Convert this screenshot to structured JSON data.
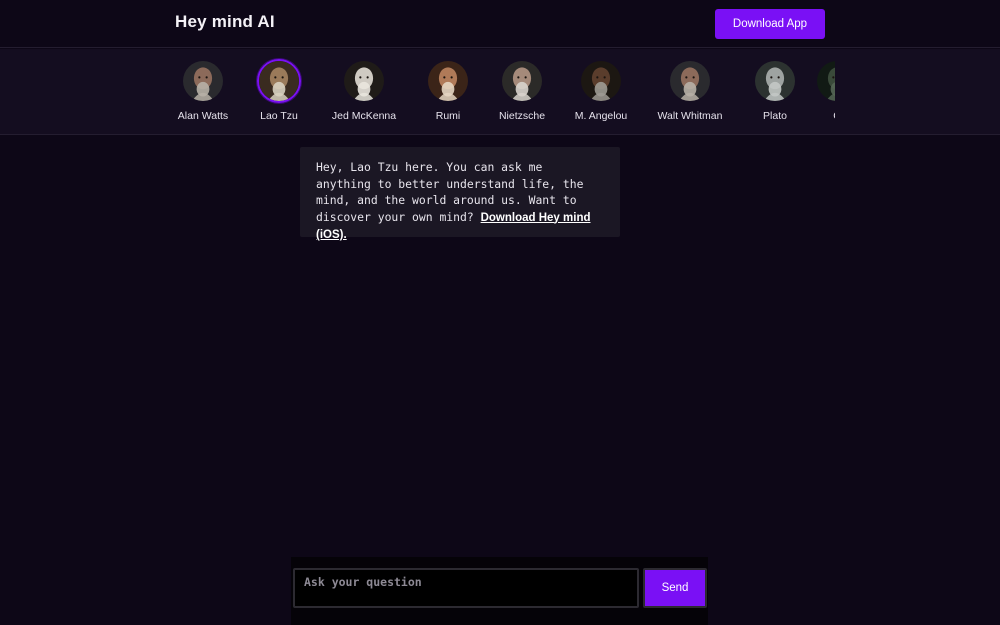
{
  "header": {
    "brand": "Hey mind AI",
    "download_label": "Download App"
  },
  "personas": [
    {
      "name": "Alan Watts",
      "icon": "portrait-bald-man-icon",
      "skin": "#8c6a5a",
      "bg": "#2a2a2e",
      "hair": "#b7b0a6",
      "active": false
    },
    {
      "name": "Lao Tzu",
      "icon": "portrait-elder-beard-icon",
      "skin": "#9a7a5a",
      "bg": "#3a2b20",
      "hair": "#d8d0c0",
      "active": true
    },
    {
      "name": "Jed McKenna",
      "icon": "portrait-dog-icon",
      "skin": "#cfcac2",
      "bg": "#1f1b18",
      "hair": "#e9e5de",
      "active": false
    },
    {
      "name": "Rumi",
      "icon": "portrait-turban-man-icon",
      "skin": "#b07a58",
      "bg": "#3b2418",
      "hair": "#e5d6c2",
      "active": false
    },
    {
      "name": "Nietzsche",
      "icon": "portrait-mustache-man-icon",
      "skin": "#a58a7a",
      "bg": "#2b2a28",
      "hair": "#d8d3cc",
      "active": false
    },
    {
      "name": "M. Angelou",
      "icon": "portrait-elder-woman-icon",
      "skin": "#5a3d2c",
      "bg": "#1c1712",
      "hair": "#9d9a94",
      "active": false
    },
    {
      "name": "Walt Whitman",
      "icon": "portrait-bald-man-icon",
      "skin": "#8c6a5a",
      "bg": "#2a2a2e",
      "hair": "#b7b0a6",
      "active": false
    },
    {
      "name": "Plato",
      "icon": "portrait-statue-icon",
      "skin": "#9ea3a1",
      "bg": "#2c3230",
      "hair": "#c3c8c5",
      "active": false
    },
    {
      "name": "C",
      "icon": "portrait-partial-icon",
      "skin": "#3a4a3a",
      "bg": "#111a14",
      "hair": "#556655",
      "active": false
    }
  ],
  "chat": {
    "message": "Hey, Lao Tzu here. You can ask me anything to better understand life, the mind, and the world around us. Want to discover your own mind? ",
    "link_label": "Download Hey mind (iOS)."
  },
  "composer": {
    "placeholder": "Ask your question",
    "value": "",
    "send_label": "Send"
  },
  "colors": {
    "accent": "#7a10f5",
    "background": "#0d0717",
    "persona_bar": "#140d20",
    "bubble": "#1b1724"
  }
}
